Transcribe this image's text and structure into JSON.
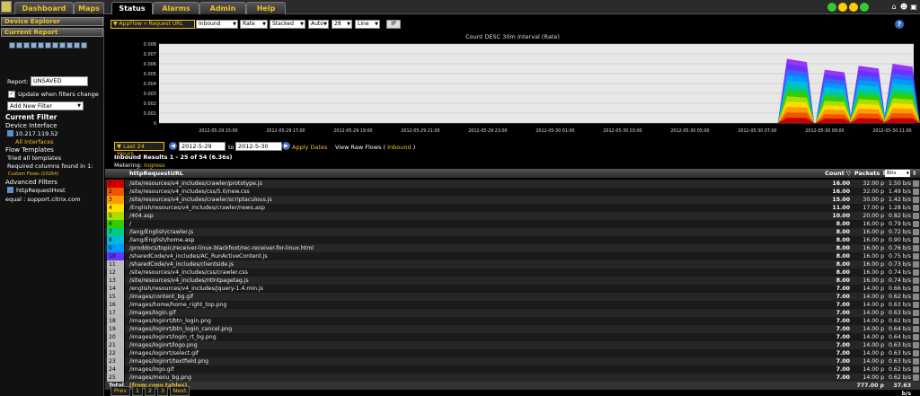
{
  "nav": {
    "tabs": [
      "Dashboard",
      "Maps",
      "Status",
      "Alarms",
      "Admin",
      "Help"
    ],
    "active": "Status"
  },
  "left": {
    "device_explorer": "Device Explorer",
    "current_report": "Current Report",
    "report_label": "Report:",
    "report_value": "UNSAVED",
    "update_label": "Update when filters change",
    "add_filter": "Add New Filter",
    "current_filter": "Current Filter",
    "device_interface": "Device Interface",
    "ip": "10.217.119.52",
    "all_interfaces": "All Interfaces",
    "flow_templates": "Flow Templates",
    "tried_templates": "Tried all templates",
    "required_columns": "Required columns found in 1:",
    "custom_flows": "Custom Flows (10264)",
    "advanced_filters": "Advanced Filters",
    "host_filter": "httpRequestHost",
    "equal_filter": "equal : support.citrix.com"
  },
  "controls": {
    "view": "AppFlow » Request URL",
    "direction": "Inbound",
    "metric": "Rate",
    "stack": "Stacked",
    "scale": "Auto",
    "count": "28",
    "chart": "Line",
    "ip_button": "IP"
  },
  "chart_data": {
    "type": "area",
    "title": "Count DESC 30m Interval (Rate)",
    "ylim": [
      0,
      0.008
    ],
    "yticks": [
      "0.008",
      "0.007",
      "0.006",
      "0.005",
      "0.004",
      "0.003",
      "0.002",
      "0.001",
      "0"
    ],
    "xticks": [
      "2012-05-29 15:00",
      "2012-05-29 17:00",
      "2012-05-29 19:00",
      "2012-05-29 21:00",
      "2012-05-29 23:00",
      "2012-05-30 01:00",
      "2012-05-30 03:00",
      "2012-05-30 05:00",
      "2012-05-30 07:00",
      "2012-05-30 09:00",
      "2012-05-30 11:00"
    ],
    "bursts": [
      {
        "start": 0.82,
        "peak": 0.0065
      },
      {
        "start": 0.87,
        "peak": 0.0054
      },
      {
        "start": 0.915,
        "peak": 0.0058
      },
      {
        "start": 0.96,
        "peak": 0.006
      }
    ],
    "colors": [
      "#cc0000",
      "#ee5500",
      "#ff9900",
      "#ffdd00",
      "#aadd00",
      "#33cc00",
      "#00cc88",
      "#00bbdd",
      "#0099ff",
      "#3366ff",
      "#6633ff",
      "#9933ff"
    ]
  },
  "timebar": {
    "range": "Last 24 Hours",
    "start": "2012-5-29 14:30",
    "to": "to",
    "end": "2012-5-30 14:30",
    "apply": "Apply Dates",
    "view_raw": "View Raw Flows (",
    "view_raw_dir": "Inbound",
    "view_raw_close": ")"
  },
  "results": {
    "summary": "Inbound Results 1 - 25 of 54 (6.36s)",
    "metering_label": "Metering:",
    "metering_value": "Ingress"
  },
  "table": {
    "col_url": "httpRequestURL",
    "col_count": "Count",
    "col_packets": "Packets",
    "col_bits": "Bits",
    "rows": [
      [
        "1",
        "/site/resources/v4_includes/crawler/prototype.js",
        "16.00",
        "32.00 p",
        "1.50 b/s",
        "#cc0000"
      ],
      [
        "2",
        "/site/resources/v4_includes/css/5.0/new.css",
        "16.00",
        "32.00 p",
        "1.49 b/s",
        "#ee5500"
      ],
      [
        "3",
        "/site/resources/v4_includes/crawler/scriptaculous.js",
        "15.00",
        "30.00 p",
        "1.42 b/s",
        "#ff9900"
      ],
      [
        "4",
        "/English/resources/v4_includes/crawler/news.asp",
        "11.00",
        "17.00 p",
        "1.28 b/s",
        "#ffdd00"
      ],
      [
        "5",
        "/404.asp",
        "10.00",
        "20.00 p",
        "0.82 b/s",
        "#aadd00"
      ],
      [
        "6",
        "/",
        "8.00",
        "16.00 p",
        "0.79 b/s",
        "#33cc00"
      ],
      [
        "7",
        "/lang/English/crawler.js",
        "8.00",
        "16.00 p",
        "0.72 b/s",
        "#00cc88"
      ],
      [
        "8",
        "/lang/English/home.asp",
        "8.00",
        "16.00 p",
        "0.90 b/s",
        "#00bbdd"
      ],
      [
        "9",
        "/proddocs/topic/receiver-linux-blackfoot/rec-receiver-for-linux.html",
        "8.00",
        "16.00 p",
        "0.76 b/s",
        "#0099ff"
      ],
      [
        "10",
        "/sharedCode/v4_includes/AC_RunActiveContent.js",
        "8.00",
        "16.00 p",
        "0.75 b/s",
        "#6633ff"
      ],
      [
        "11",
        "/sharedCode/v4_includes/clientside.js",
        "8.00",
        "16.00 p",
        "0.73 b/s",
        ""
      ],
      [
        "12",
        "/site/resources/v4_includes/css/crawler.css",
        "8.00",
        "16.00 p",
        "0.74 b/s",
        ""
      ],
      [
        "13",
        "/site/resources/v4_includes/ntlntpagetag.js",
        "8.00",
        "16.00 p",
        "0.74 b/s",
        ""
      ],
      [
        "14",
        "/english/resources/v4_includes/jquery-1.4.min.js",
        "7.00",
        "14.00 p",
        "0.66 b/s",
        ""
      ],
      [
        "15",
        "/images/content_bg.gif",
        "7.00",
        "14.00 p",
        "0.62 b/s",
        ""
      ],
      [
        "16",
        "/images/home/home_right_top.png",
        "7.00",
        "14.00 p",
        "0.63 b/s",
        ""
      ],
      [
        "17",
        "/images/login.gif",
        "7.00",
        "14.00 p",
        "0.63 b/s",
        ""
      ],
      [
        "18",
        "/images/loginrt/btn_login.png",
        "7.00",
        "14.00 p",
        "0.62 b/s",
        ""
      ],
      [
        "19",
        "/images/loginrt/btn_login_cancel.png",
        "7.00",
        "14.00 p",
        "0.64 b/s",
        ""
      ],
      [
        "20",
        "/images/loginrt/login_rt_bg.png",
        "7.00",
        "14.00 p",
        "0.64 b/s",
        ""
      ],
      [
        "21",
        "/images/loginrt/logo.png",
        "7.00",
        "14.00 p",
        "0.63 b/s",
        ""
      ],
      [
        "22",
        "/images/loginrt/select.gif",
        "7.00",
        "14.00 p",
        "0.63 b/s",
        ""
      ],
      [
        "23",
        "/images/loginrt/textfield.png",
        "7.00",
        "14.00 p",
        "0.63 b/s",
        ""
      ],
      [
        "24",
        "/images/logo.gif",
        "7.00",
        "14.00 p",
        "0.62 b/s",
        ""
      ],
      [
        "25",
        "/images/menu_bg.png",
        "7.00",
        "14.00 p",
        "0.62 b/s",
        ""
      ]
    ],
    "total_label": "Total",
    "total_note": "(from conv tables)",
    "total_packets": "777.00 p",
    "total_bits": "37.63 b/s"
  },
  "pager": {
    "prev": "Prev",
    "pages": [
      "1",
      "2",
      "3"
    ],
    "next": "Next"
  }
}
